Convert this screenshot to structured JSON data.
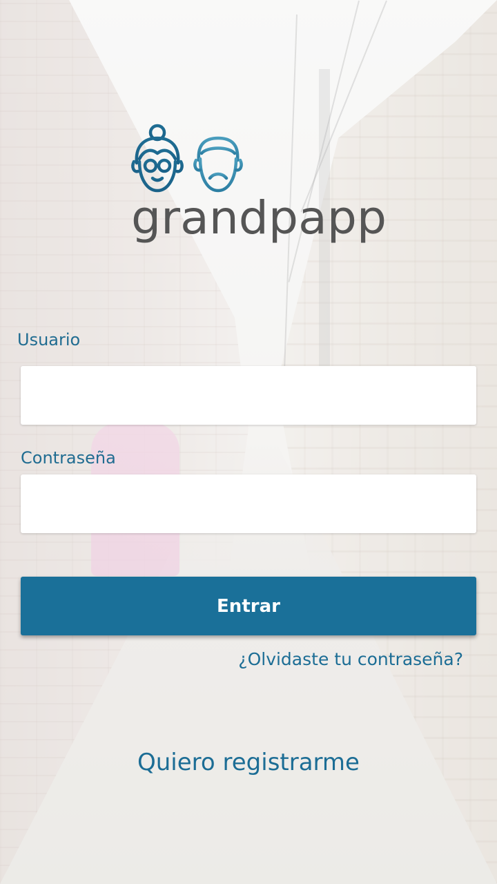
{
  "app": {
    "brand_name": "grandpapp",
    "brand_color": "#206c91",
    "wordmark_color": "#555555",
    "logo_icons": [
      "grandma-face-icon",
      "grandpa-face-icon"
    ]
  },
  "login_form": {
    "username_label": "Usuario",
    "username_value": "",
    "password_label": "Contraseña",
    "password_value": "",
    "submit_label": "Entrar",
    "submit_color": "#1a7099"
  },
  "links": {
    "forgot_password": "¿Olvidaste tu contraseña?",
    "register": "Quiero registrarme"
  }
}
